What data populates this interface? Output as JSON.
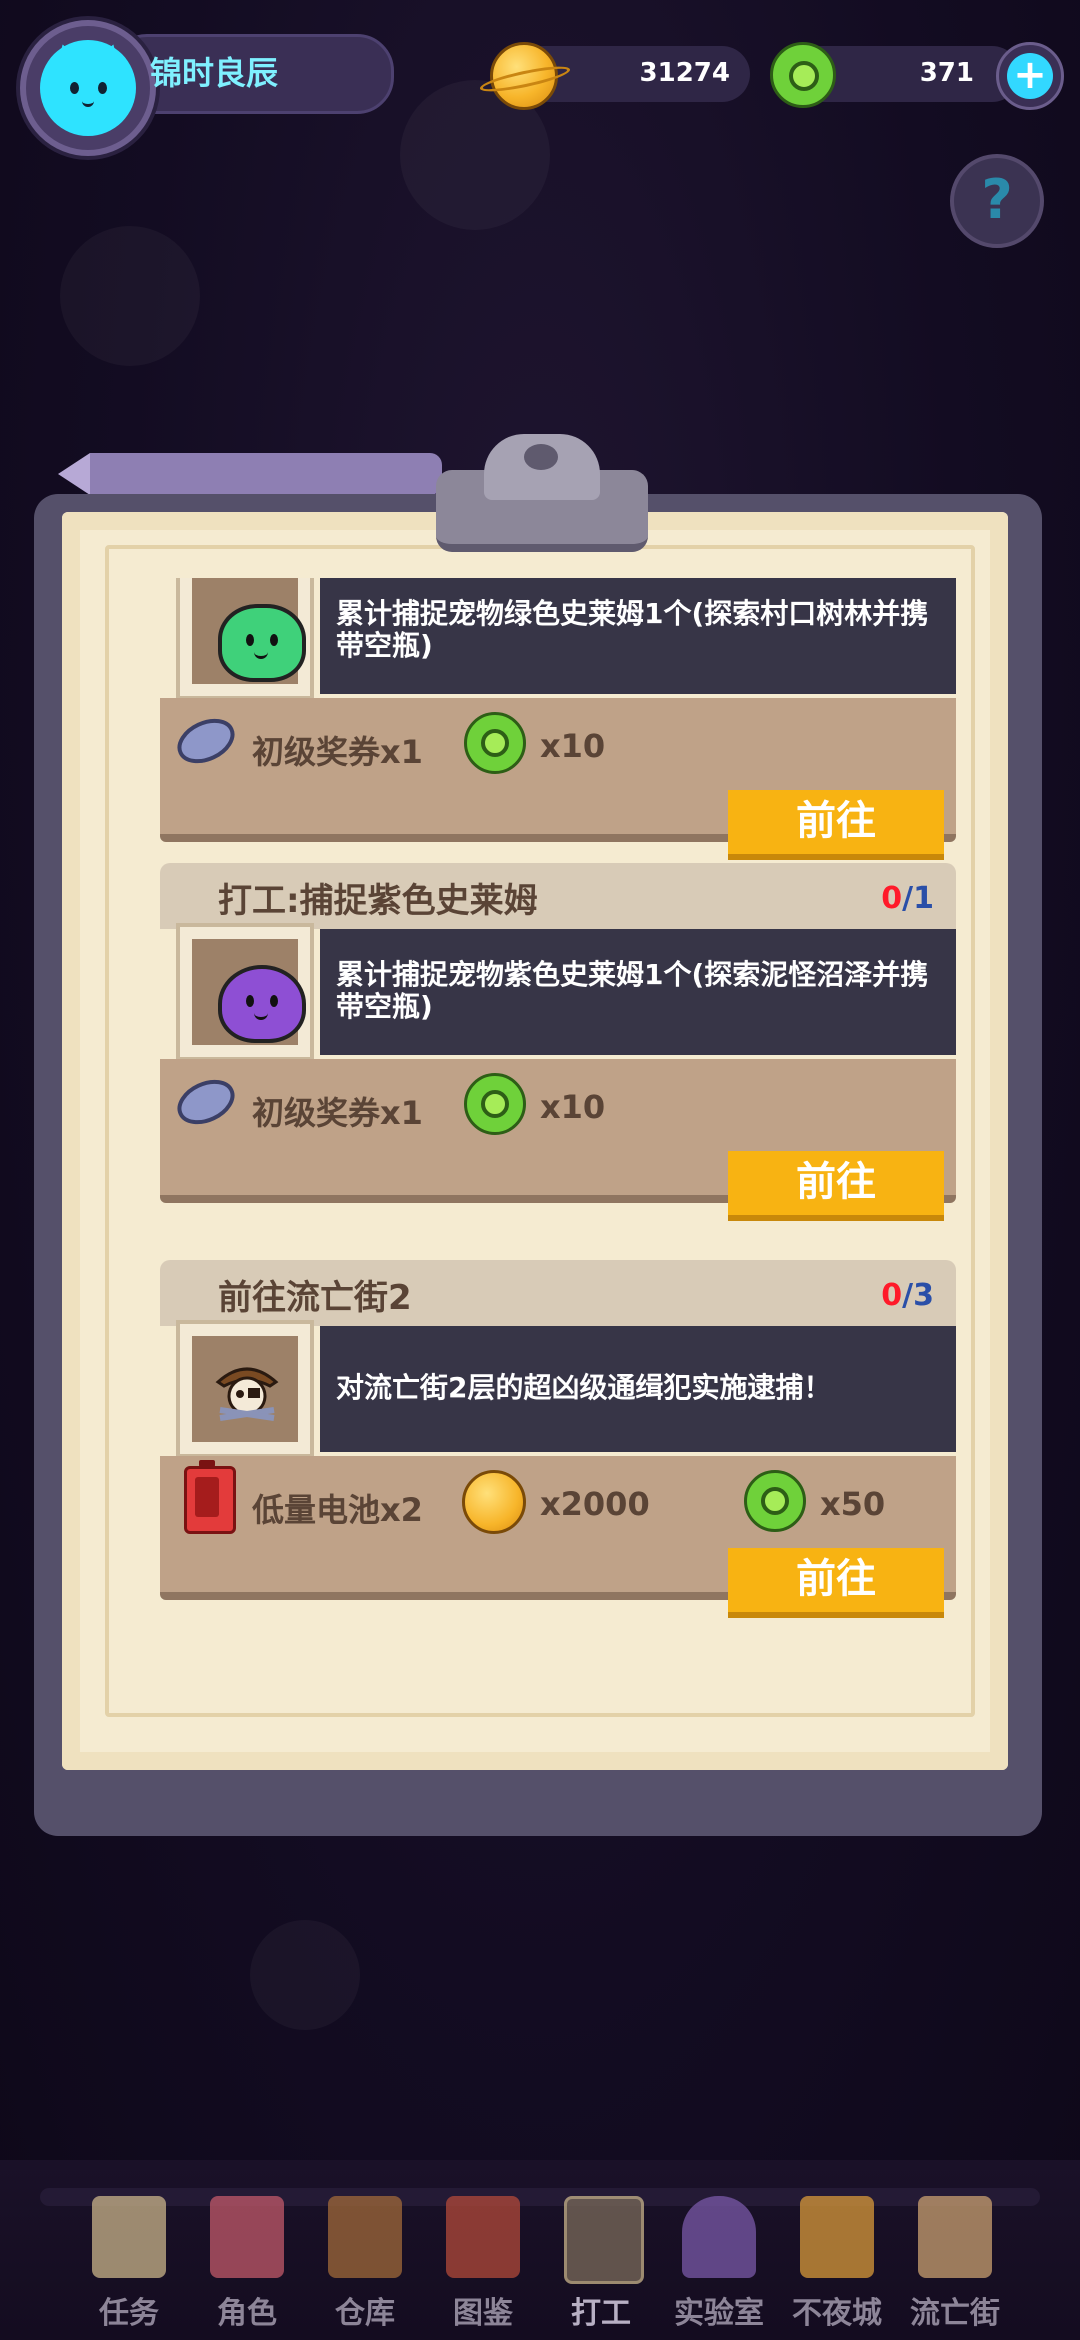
{
  "player": {
    "name": "锦时良辰"
  },
  "currency": {
    "coins": "31274",
    "gems": "371"
  },
  "tasks": [
    {
      "title": "",
      "desc": "累计捕捉宠物绿色史莱姆1个(探索村口树林并携带空瓶)",
      "progress_cur": "",
      "progress_total": "",
      "reward1_label": "初级奖券x1",
      "reward2_label": "x10",
      "button": "前往",
      "slime_color": "#3fd17a"
    },
    {
      "title": "打工:捕捉紫色史莱姆",
      "desc": "累计捕捉宠物紫色史莱姆1个(探索泥怪沼泽并携带空瓶)",
      "progress_cur": "0",
      "progress_total": "/1",
      "reward1_label": "初级奖券x1",
      "reward2_label": "x10",
      "button": "前往",
      "slime_color": "#8e4fd4"
    },
    {
      "title": "前往流亡街2",
      "desc": "对流亡街2层的超凶级通缉犯实施逮捕！",
      "progress_cur": "0",
      "progress_total": "/3",
      "reward1_label": "低量电池x2",
      "reward2_label": "x2000",
      "reward3_label": "x50",
      "button": "前往"
    }
  ],
  "nav": [
    {
      "label": "任务",
      "color": "#c9b48a"
    },
    {
      "label": "角色",
      "color": "#c25a6a"
    },
    {
      "label": "仓库",
      "color": "#a06a3a"
    },
    {
      "label": "图鉴",
      "color": "#b24a3a"
    },
    {
      "label": "打工",
      "color": "#7a6a5a"
    },
    {
      "label": "实验室",
      "color": "#7a5aa8"
    },
    {
      "label": "不夜城",
      "color": "#d89a3a"
    },
    {
      "label": "流亡街",
      "color": "#c9a070"
    }
  ]
}
